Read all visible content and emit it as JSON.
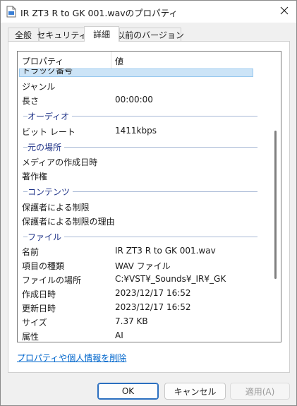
{
  "window": {
    "title": "IR ZT3 R to GK 001.wavのプロパティ",
    "close_glyph": "✕"
  },
  "tabs": [
    {
      "label": "全般",
      "active": false
    },
    {
      "label": "セキュリティ",
      "active": false
    },
    {
      "label": "詳細",
      "active": true
    },
    {
      "label": "以前のバージョン",
      "active": false
    }
  ],
  "list": {
    "header": {
      "property": "プロパティ",
      "value": "値"
    },
    "rows": [
      {
        "kind": "row",
        "key": "トラック番号",
        "value": "",
        "selected": true
      },
      {
        "kind": "row",
        "key": "ジャンル",
        "value": ""
      },
      {
        "kind": "row",
        "key": "長さ",
        "value": "00:00:00"
      },
      {
        "kind": "group",
        "title": "オーディオ"
      },
      {
        "kind": "row",
        "key": "ビット レート",
        "value": "1411kbps"
      },
      {
        "kind": "group",
        "title": "元の場所"
      },
      {
        "kind": "row",
        "key": "メディアの作成日時",
        "value": ""
      },
      {
        "kind": "row",
        "key": "著作権",
        "value": ""
      },
      {
        "kind": "group",
        "title": "コンテンツ"
      },
      {
        "kind": "row",
        "key": "保護者による制限",
        "value": ""
      },
      {
        "kind": "row",
        "key": "保護者による制限の理由",
        "value": ""
      },
      {
        "kind": "group",
        "title": "ファイル"
      },
      {
        "kind": "row",
        "key": "名前",
        "value": "IR ZT3 R to GK 001.wav"
      },
      {
        "kind": "row",
        "key": "項目の種類",
        "value": "WAV ファイル"
      },
      {
        "kind": "row",
        "key": "ファイルの場所",
        "value": "C:¥VST¥_Sounds¥_IR¥_GK"
      },
      {
        "kind": "row",
        "key": "作成日時",
        "value": "2023/12/17 16:52"
      },
      {
        "kind": "row",
        "key": "更新日時",
        "value": "2023/12/17 16:52"
      },
      {
        "kind": "row",
        "key": "サイズ",
        "value": "7.37 KB"
      },
      {
        "kind": "row",
        "key": "属性",
        "value": "AI"
      }
    ]
  },
  "remove_link": "プロパティや個人情報を削除",
  "buttons": {
    "ok": "OK",
    "cancel": "キャンセル",
    "apply": "適用(A)"
  },
  "icons": {
    "title": "wav-file-icon",
    "close": "close-icon"
  },
  "colors": {
    "group_title": "#1e3287",
    "selection": "#cce4f7",
    "link": "#0066cc"
  }
}
